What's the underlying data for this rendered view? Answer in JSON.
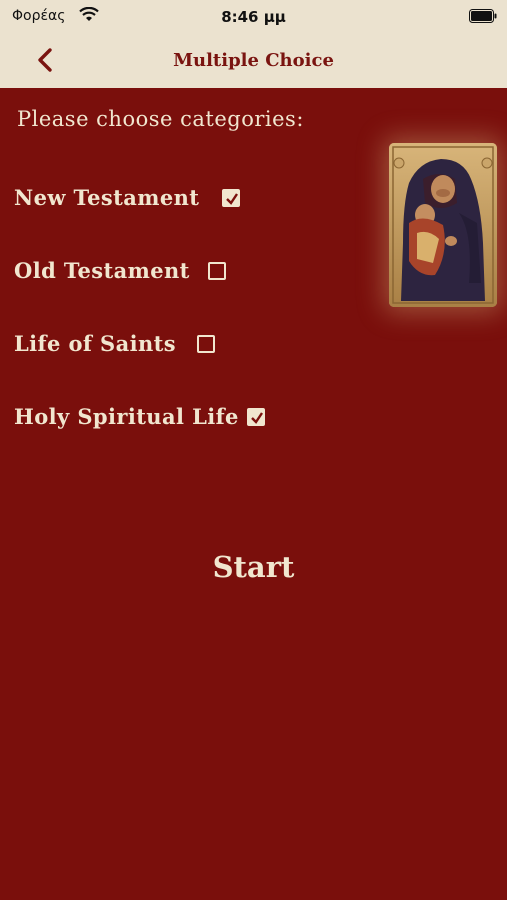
{
  "status_bar": {
    "carrier": "Φορέας",
    "time": "8:46 μμ"
  },
  "nav": {
    "title": "Multiple Choice"
  },
  "prompt": "Please choose categories:",
  "categories": [
    {
      "label": "New Testament",
      "checked": true
    },
    {
      "label": "Old Testament",
      "checked": false
    },
    {
      "label": "Life of Saints",
      "checked": false
    },
    {
      "label": "Holy Spiritual Life",
      "checked": true
    }
  ],
  "start_label": "Start",
  "colors": {
    "background": "#7a0f0c",
    "bar": "#ebe2cf",
    "text": "#f1e6cf",
    "title": "#7a1410"
  }
}
